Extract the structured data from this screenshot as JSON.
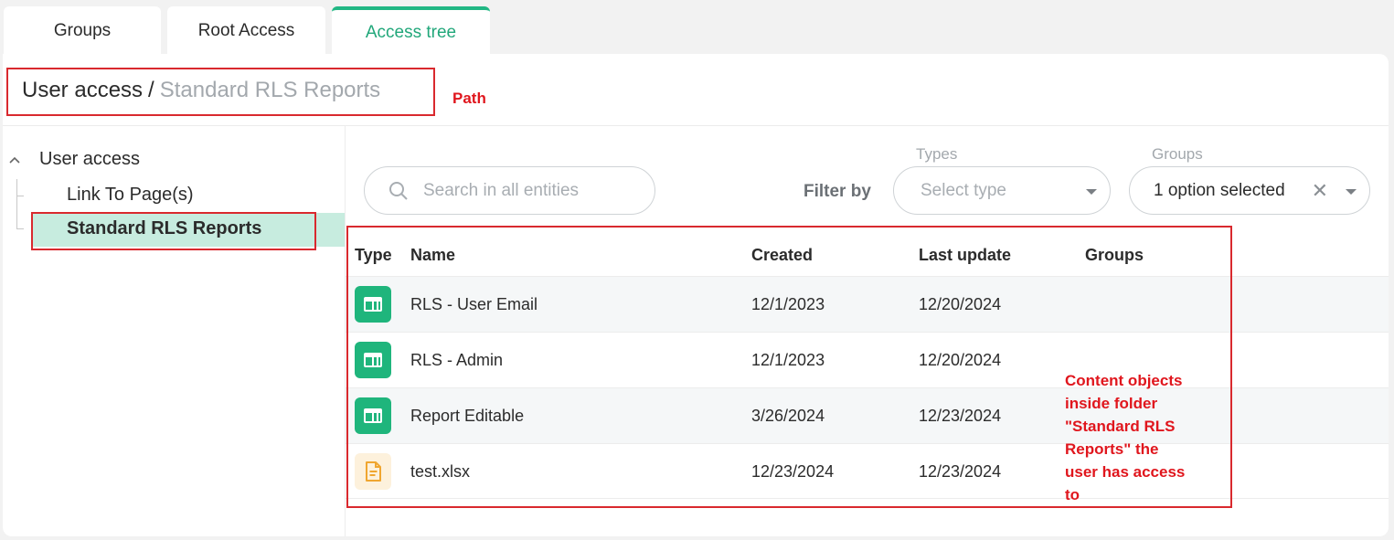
{
  "tabs": [
    {
      "label": "Groups",
      "active": false
    },
    {
      "label": "Root Access",
      "active": false
    },
    {
      "label": "Access tree",
      "active": true
    }
  ],
  "breadcrumb": {
    "root": "User access",
    "separator": "/",
    "current": "Standard RLS Reports"
  },
  "tree": {
    "root_label": "User access",
    "items": [
      {
        "label": "Link To Page(s)",
        "selected": false
      },
      {
        "label": "Standard RLS Reports",
        "selected": true
      }
    ]
  },
  "search": {
    "placeholder": "Search in all entities"
  },
  "filters": {
    "filter_by_label": "Filter by",
    "types_label": "Types",
    "types_placeholder": "Select type",
    "groups_label": "Groups",
    "groups_value": "1 option selected"
  },
  "table": {
    "columns": [
      "Type",
      "Name",
      "Created",
      "Last update",
      "Groups"
    ],
    "rows": [
      {
        "type_icon": "report-icon",
        "name": "RLS - User Email",
        "created": "12/1/2023",
        "updated": "12/20/2024",
        "groups": ""
      },
      {
        "type_icon": "report-icon",
        "name": "RLS - Admin",
        "created": "12/1/2023",
        "updated": "12/20/2024",
        "groups": ""
      },
      {
        "type_icon": "report-icon",
        "name": "Report Editable",
        "created": "3/26/2024",
        "updated": "12/23/2024",
        "groups": ""
      },
      {
        "type_icon": "file-icon",
        "name": "test.xlsx",
        "created": "12/23/2024",
        "updated": "12/23/2024",
        "groups": ""
      }
    ]
  },
  "annotations": {
    "path_label": "Path",
    "content_label_lines": [
      "Content objects",
      "inside folder",
      "\"Standard RLS",
      "Reports\" the",
      "user has access",
      "to"
    ]
  },
  "colors": {
    "accent": "#21b784",
    "selected_bg": "#c7ecdf",
    "annotation": "#d9292e",
    "file_icon": "#f0a630"
  }
}
